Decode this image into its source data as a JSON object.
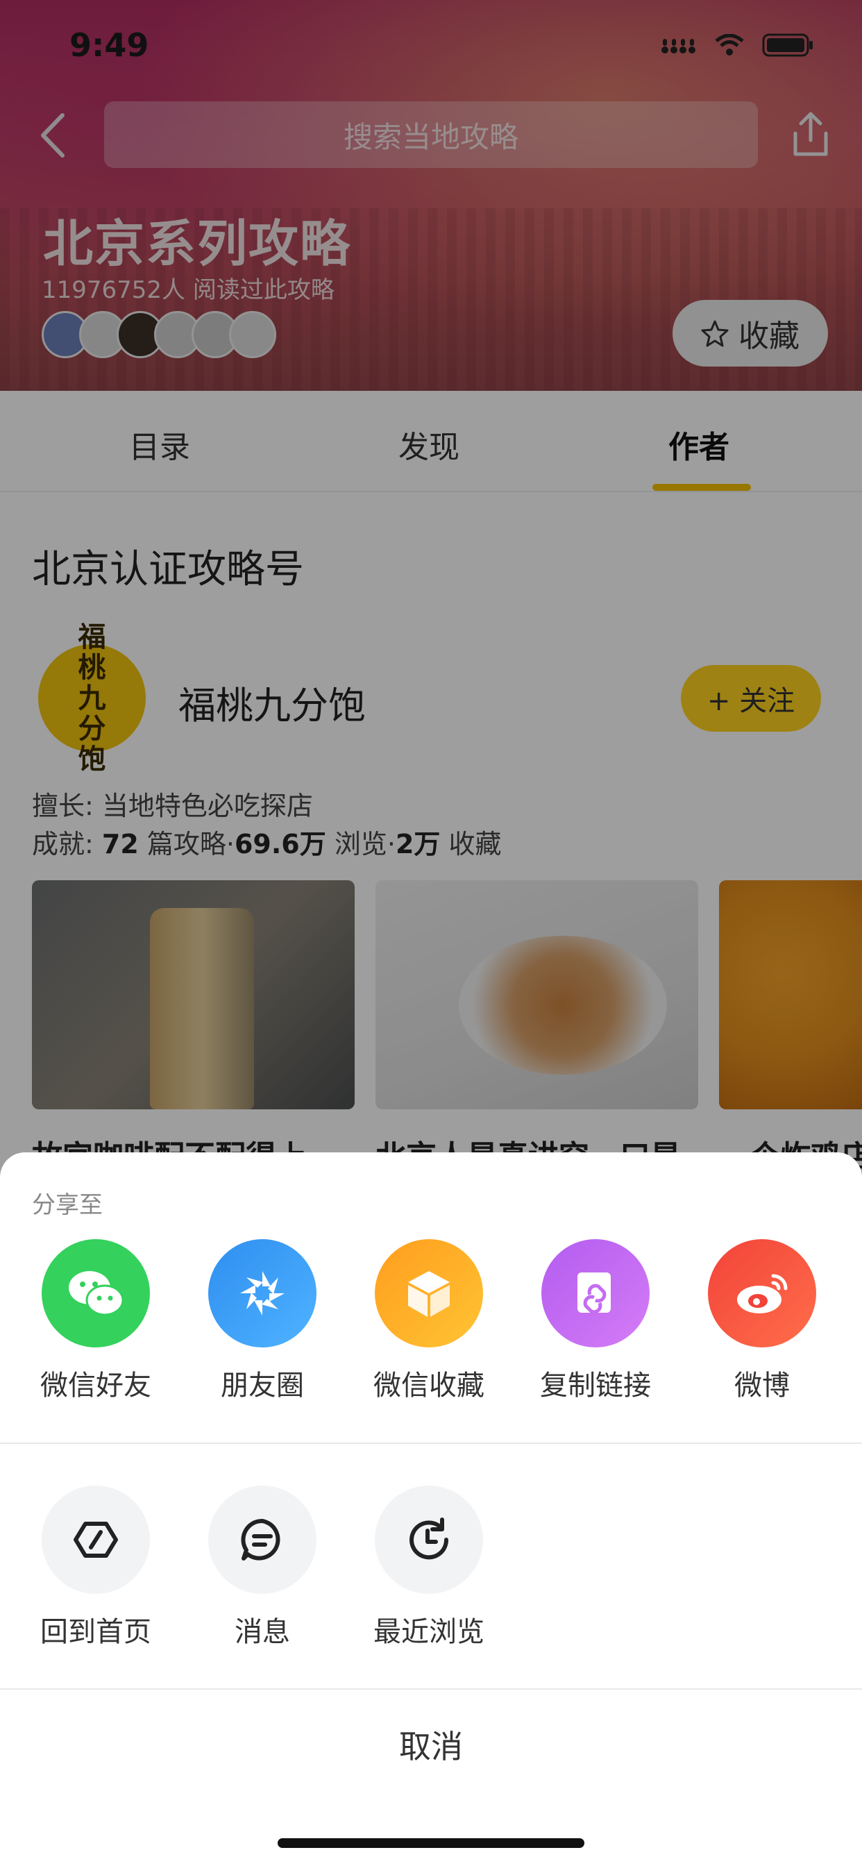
{
  "status": {
    "time": "9:49"
  },
  "header": {
    "search_placeholder": "搜索当地攻略"
  },
  "hero": {
    "title": "北京系列攻略",
    "readers": "11976752人 阅读过此攻略",
    "collect_label": "收藏"
  },
  "tabs": [
    {
      "label": "目录"
    },
    {
      "label": "发现"
    },
    {
      "label": "作者",
      "active": true
    }
  ],
  "section": {
    "title": "北京认证攻略号"
  },
  "author": {
    "avatar_text": "福桃九分饱",
    "name": "福桃九分饱",
    "follow_label": "+ 关注",
    "specialty_label": "擅长:",
    "specialty": "当地特色必吃探店",
    "achievement_label": "成就:",
    "articles_count": "72",
    "articles_unit": "篇攻略·",
    "views_count": "69.6万",
    "views_unit": "浏览·",
    "favorites_count": "2万",
    "favorites_unit": "收藏"
  },
  "cards": [
    {
      "title": "故宫咖啡配不配得上"
    },
    {
      "title": "北京人是真讲究，口是"
    },
    {
      "title": "一个炸鸡店"
    }
  ],
  "share_sheet": {
    "title": "分享至",
    "targets": [
      {
        "label": "微信好友",
        "icon": "wechat-icon",
        "color": "#34d15c"
      },
      {
        "label": "朋友圈",
        "icon": "moments-icon",
        "color": "#3d9cf5"
      },
      {
        "label": "微信收藏",
        "icon": "wechat-favorite-icon",
        "color": "#ffb21e"
      },
      {
        "label": "复制链接",
        "icon": "copy-link-icon",
        "color": "#c86cf0"
      },
      {
        "label": "微博",
        "icon": "weibo-icon",
        "color": "#f55a40"
      }
    ],
    "tools": [
      {
        "label": "回到首页",
        "icon": "home-icon"
      },
      {
        "label": "消息",
        "icon": "message-icon"
      },
      {
        "label": "最近浏览",
        "icon": "history-icon"
      }
    ],
    "cancel_label": "取消"
  }
}
